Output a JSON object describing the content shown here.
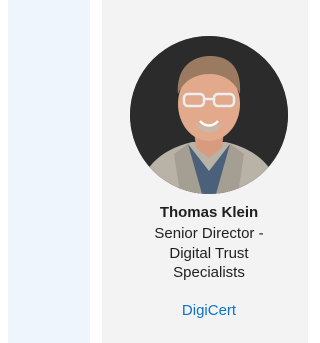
{
  "speaker": {
    "name": "Thomas Klein",
    "title_lines": [
      "Senior Director -",
      "Digital Trust",
      "Specialists"
    ],
    "company": "DigiCert",
    "avatar_icon": "speaker-photo",
    "company_color": "#0a74c9"
  }
}
